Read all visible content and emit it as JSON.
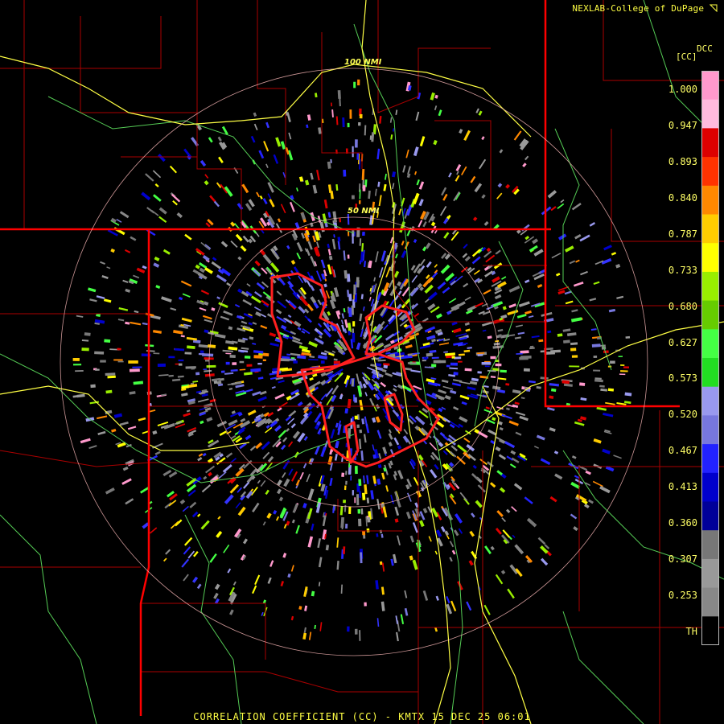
{
  "header": {
    "credit": "NEXLAB-College of DuPage"
  },
  "legend": {
    "title": "DCC",
    "unit": "[CC]",
    "ticks": [
      "1.000",
      "0.947",
      "0.893",
      "0.840",
      "0.787",
      "0.733",
      "0.680",
      "0.627",
      "0.573",
      "0.520",
      "0.467",
      "0.413",
      "0.360",
      "0.307",
      "0.253",
      "TH"
    ],
    "colors": [
      "#ff99cc",
      "#ffbbdd",
      "#dd0000",
      "#ff3300",
      "#ff8800",
      "#ffcc00",
      "#ffff00",
      "#99ee00",
      "#66cc00",
      "#44ff44",
      "#22dd22",
      "#9999ee",
      "#7777dd",
      "#2222ff",
      "#0000cc",
      "#000099",
      "#777777",
      "#999999",
      "#888888",
      "#000000"
    ]
  },
  "rings": {
    "inner_label": "50 NMI",
    "outer_label": "100 NMI"
  },
  "footer": {
    "caption": "CORRELATION COEFFICIENT (CC) - KMTX 15 DEC 25 06:01"
  },
  "colors": {
    "state_border": "#ff0000",
    "county_border": "#aa0000",
    "highway": "#ffff44",
    "river": "#55cc55",
    "ring": "#ffbbbb",
    "warning_outline": "#ff2020"
  }
}
